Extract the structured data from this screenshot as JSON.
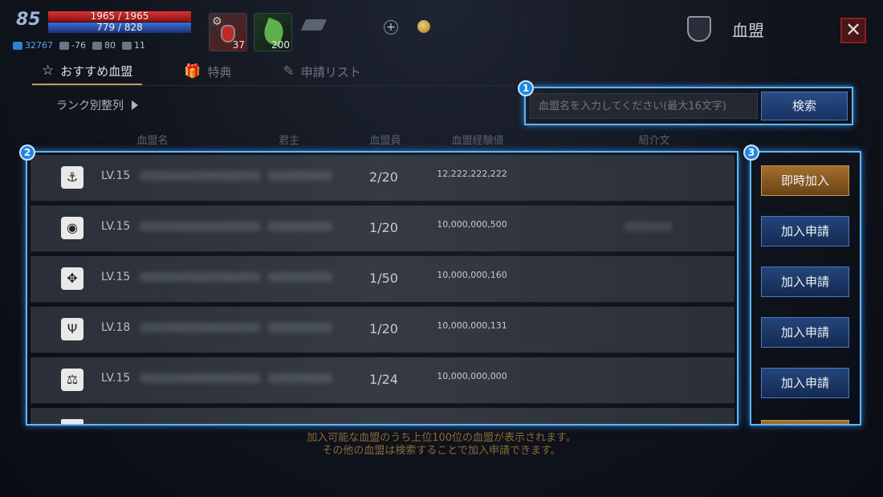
{
  "player": {
    "level": "85",
    "hp": "1965 / 1965",
    "mp": "779 / 828",
    "stats": [
      {
        "icon": "power-icon",
        "value": "32767"
      },
      {
        "icon": "helmet-icon",
        "value": "-76"
      },
      {
        "icon": "boot-icon",
        "value": "80"
      },
      {
        "icon": "weight-icon",
        "value": "11"
      }
    ]
  },
  "quick_items": {
    "potion_count": "37",
    "leaf_count": "200"
  },
  "header": {
    "title": "血盟",
    "close_icon": "✕"
  },
  "tabs": [
    {
      "label": "おすすめ血盟",
      "icon": "☆",
      "active": true
    },
    {
      "label": "特典",
      "icon": "🎁",
      "active": false
    },
    {
      "label": "申請リスト",
      "icon": "✎",
      "active": false
    }
  ],
  "sort": {
    "label": "ランク別整列"
  },
  "search": {
    "placeholder": "血盟名を入力してください(最大16文字)",
    "button": "検索"
  },
  "columns": {
    "name": "血盟名",
    "lord": "君主",
    "members": "血盟員",
    "exp": "血盟経験値",
    "intro": "紹介文"
  },
  "rows": [
    {
      "emblem": "anchor-emblem-icon",
      "glyph": "⚓",
      "level": "LV.15",
      "members": "2/20",
      "exp": "12,222,222,222",
      "action": "即時加入"
    },
    {
      "emblem": "flag-emblem-icon",
      "glyph": "◉",
      "level": "LV.15",
      "members": "1/20",
      "exp": "10,000,000,500",
      "action": "加入申請"
    },
    {
      "emblem": "turtle-emblem-icon",
      "glyph": "✥",
      "level": "LV.15",
      "members": "1/50",
      "exp": "10,000,000,160",
      "action": "加入申請"
    },
    {
      "emblem": "trident-emblem-icon",
      "glyph": "Ψ",
      "level": "LV.18",
      "members": "1/20",
      "exp": "10,000,000,131",
      "action": "加入申請"
    },
    {
      "emblem": "scales-emblem-icon",
      "glyph": "⚖",
      "level": "LV.15",
      "members": "1/24",
      "exp": "10,000,000,000",
      "action": "加入申請"
    }
  ],
  "badges": {
    "b1": "1",
    "b2": "2",
    "b3": "3"
  },
  "footer": {
    "line1": "加入可能な血盟のうち上位100位の血盟が表示されます。",
    "line2": "その他の血盟は検索することで加入申請できます。"
  }
}
